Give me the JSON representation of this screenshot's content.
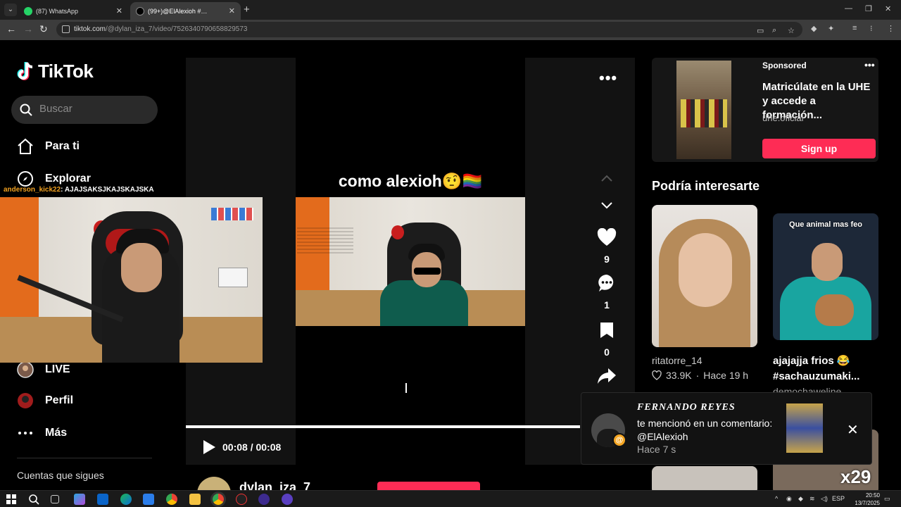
{
  "browser": {
    "tabs": [
      {
        "title": "(87) WhatsApp"
      },
      {
        "title": "(99+)@ElAlexioh #…"
      }
    ],
    "url_host": "tiktok.com",
    "url_path": "/@dylan_iza_7/video/7526340790658829573"
  },
  "sidebar": {
    "logo": "TikTok",
    "search_placeholder": "Buscar",
    "nav": [
      {
        "label": "Para ti"
      },
      {
        "label": "Explorar"
      },
      {
        "label": "LIVE"
      },
      {
        "label": "Perfil"
      },
      {
        "label": "Más"
      }
    ],
    "following_label": "Cuentas que sigues"
  },
  "stream_overlay": {
    "chat_user": "anderson_kick22",
    "chat_message": ": AJAJSAKSJKAJSKAJSKA"
  },
  "video": {
    "caption": "como alexioh🤨🏳️‍🌈",
    "likes": "9",
    "comments": "1",
    "saves": "0",
    "time": "00:08 / 00:08",
    "progress": 1.0,
    "author": "dylan_iza_7"
  },
  "ad": {
    "label": "Sponsored",
    "title": "Matricúlate en la UHE y accede a formación...",
    "handle": "uhe.oficial",
    "button": "Sign up"
  },
  "recommendations": {
    "title": "Podría interesarte",
    "items": [
      {
        "user": "ritatorre_14",
        "likes": "33.9K",
        "age": "Hace 19 h"
      },
      {
        "overlay": "Que animal mas feo",
        "desc": "ajajajja frios 😂 #sachauzumaki...",
        "user": "demochaweline"
      }
    ],
    "thumb4_label": "x29"
  },
  "notification": {
    "name": "FERNANDO REYES",
    "text": "te mencionó en un comentario: @ElAlexioh",
    "time": "Hace 7 s"
  },
  "taskbar": {
    "lang": "ESP",
    "time": "20:50",
    "date": "13/7/2025"
  },
  "colors": {
    "accent": "#fe2c55",
    "background": "#000000"
  }
}
